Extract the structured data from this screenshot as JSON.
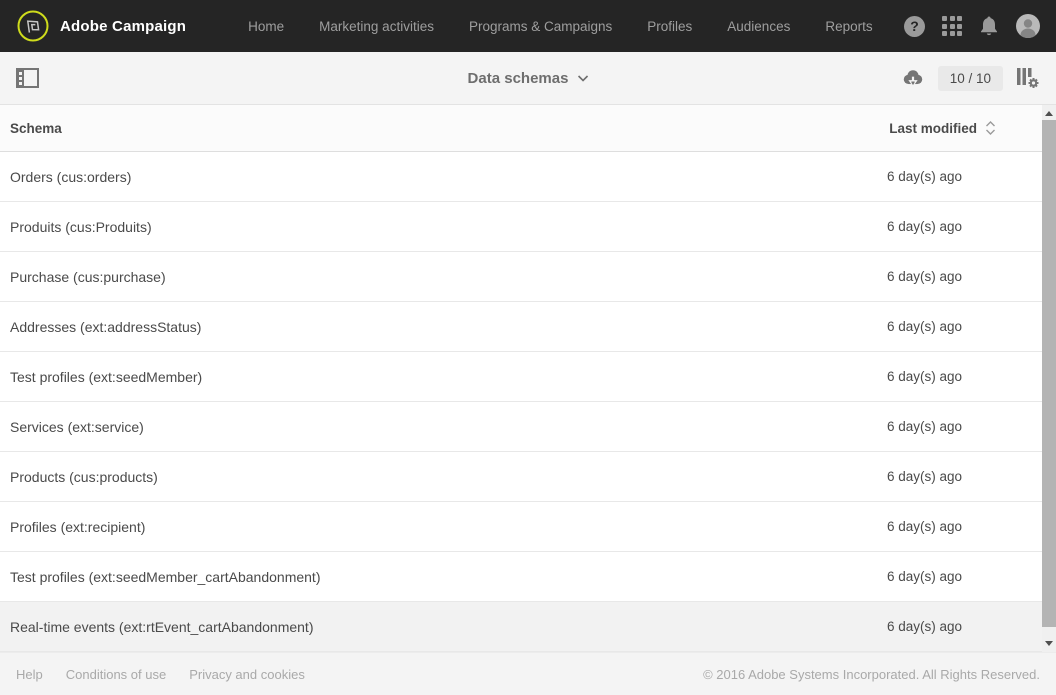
{
  "colors": {
    "navbar_bg": "#252525",
    "logo_ring": "#cfdc1c",
    "toolbar_bg": "#f4f4f4",
    "row_highlight": "#f2f2f2",
    "text_primary": "#4a4a4a",
    "text_muted": "#9e9e9e"
  },
  "navbar": {
    "brand": "Adobe Campaign",
    "help_glyph": "?",
    "items": [
      {
        "label": "Home"
      },
      {
        "label": "Marketing activities"
      },
      {
        "label": "Programs & Campaigns"
      },
      {
        "label": "Profiles"
      },
      {
        "label": "Audiences"
      },
      {
        "label": "Reports"
      }
    ]
  },
  "toolbar": {
    "title": "Data schemas",
    "counter": "10 / 10"
  },
  "table": {
    "columns": {
      "schema": "Schema",
      "last_modified": "Last modified"
    },
    "rows": [
      {
        "schema": "Orders (cus:orders)",
        "last_modified": "6 day(s) ago",
        "highlighted": false
      },
      {
        "schema": "Produits (cus:Produits)",
        "last_modified": "6 day(s) ago",
        "highlighted": false
      },
      {
        "schema": "Purchase (cus:purchase)",
        "last_modified": "6 day(s) ago",
        "highlighted": false
      },
      {
        "schema": "Addresses (ext:addressStatus)",
        "last_modified": "6 day(s) ago",
        "highlighted": false
      },
      {
        "schema": "Test profiles (ext:seedMember)",
        "last_modified": "6 day(s) ago",
        "highlighted": false
      },
      {
        "schema": "Services (ext:service)",
        "last_modified": "6 day(s) ago",
        "highlighted": false
      },
      {
        "schema": "Products (cus:products)",
        "last_modified": "6 day(s) ago",
        "highlighted": false
      },
      {
        "schema": "Profiles (ext:recipient)",
        "last_modified": "6 day(s) ago",
        "highlighted": false
      },
      {
        "schema": "Test profiles (ext:seedMember_cartAbandonment)",
        "last_modified": "6 day(s) ago",
        "highlighted": false
      },
      {
        "schema": "Real-time events (ext:rtEvent_cartAbandonment)",
        "last_modified": "6 day(s) ago",
        "highlighted": true
      }
    ]
  },
  "footer": {
    "links": [
      "Help",
      "Conditions of use",
      "Privacy and cookies"
    ],
    "copyright": "© 2016 Adobe Systems Incorporated. All Rights Reserved."
  }
}
